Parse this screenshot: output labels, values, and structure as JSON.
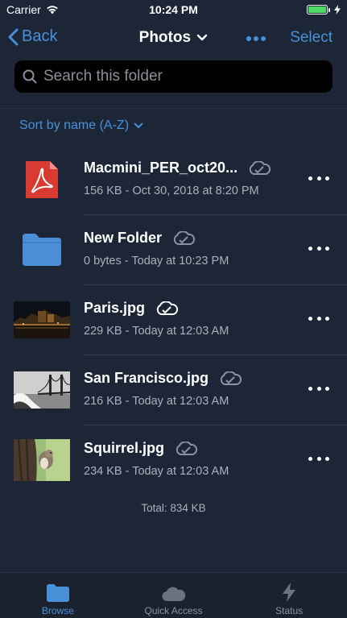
{
  "status_bar": {
    "carrier": "Carrier",
    "time": "10:24 PM",
    "battery_level": 1.0
  },
  "nav": {
    "back_label": "Back",
    "title": "Photos",
    "select_label": "Select",
    "more_icon": "ellipsis-icon"
  },
  "search": {
    "placeholder": "Search this folder",
    "value": ""
  },
  "sort": {
    "label": "Sort by name (A-Z)"
  },
  "files": [
    {
      "name": "Macmini_PER_oct20...",
      "meta": "156 KB - Oct 30, 2018 at 8:20 PM",
      "type": "pdf",
      "icon": "pdf-icon"
    },
    {
      "name": "New Folder",
      "meta": "0 bytes - Today at 10:23 PM",
      "type": "folder",
      "icon": "folder-icon"
    },
    {
      "name": "Paris.jpg",
      "meta": "229 KB - Today at 12:03 AM",
      "type": "image",
      "icon": "paris-thumbnail"
    },
    {
      "name": "San Francisco.jpg",
      "meta": "216 KB - Today at 12:03 AM",
      "type": "image",
      "icon": "san-francisco-thumbnail"
    },
    {
      "name": "Squirrel.jpg",
      "meta": "234 KB - Today at 12:03 AM",
      "type": "image",
      "icon": "squirrel-thumbnail"
    }
  ],
  "total": "Total: 834 KB",
  "tabs": [
    {
      "label": "Browse",
      "icon": "folder-icon",
      "active": true
    },
    {
      "label": "Quick Access",
      "icon": "cloud-icon",
      "active": false
    },
    {
      "label": "Status",
      "icon": "lightning-icon",
      "active": false
    }
  ],
  "colors": {
    "background": "#1c2636",
    "accent": "#4a90d9",
    "search_bg": "#000000",
    "pdf_red": "#d93a31",
    "folder_blue": "#4a8fd6"
  }
}
